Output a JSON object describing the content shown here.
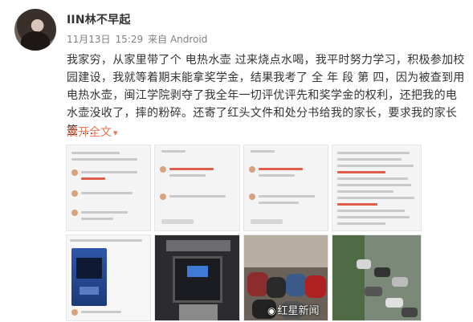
{
  "author": {
    "name": "IIN林不早起"
  },
  "post_meta": {
    "date": "11月13日",
    "time": "15:29",
    "source": "来自 Android"
  },
  "post_text": "我家穷，从家里带了个 电热水壶 过来烧点水喝，我平时努力学习，积极参加校园建设，我就等着期末能拿奖学金，结果我考了 全 年 段 第 四，因为被查到用电热水壶，闽江学院剥夺了我全年一切评优评先和奖学金的权利，还把我的电水壶没收了，摔的粉碎。还寄了红头文件和处分书给我的家长，要求我的家长签 ...",
  "expand_label": "展开全文",
  "expand_icon": "chevron-down-icon",
  "watermark": "红星新闻",
  "colors": {
    "accent": "#eb7350",
    "meta": "#808080",
    "text": "#333333"
  }
}
